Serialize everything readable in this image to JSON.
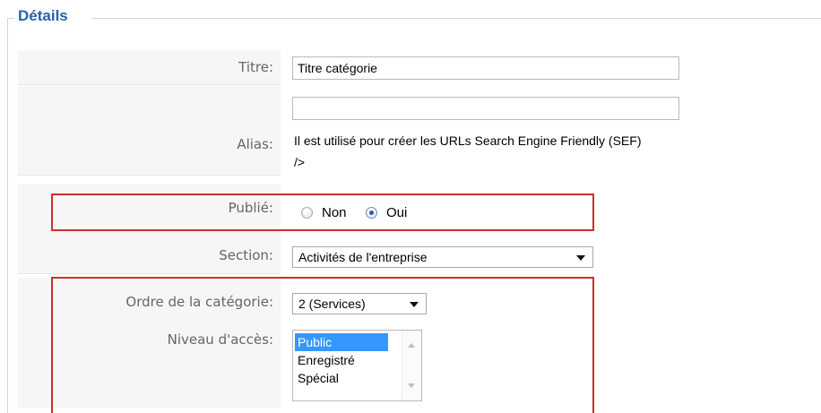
{
  "fieldset": {
    "legend": "Détails"
  },
  "titre": {
    "label": "Titre:",
    "value": "Titre catégorie"
  },
  "alias": {
    "label": "Alias:",
    "value": "",
    "help": "Il est utilisé pour créer les URLs Search Engine Friendly (SEF)",
    "help_cont": "/>"
  },
  "publie": {
    "label": "Publié:",
    "options": [
      {
        "label": "Non",
        "checked": false
      },
      {
        "label": "Oui",
        "checked": true
      }
    ]
  },
  "section": {
    "label": "Section:",
    "selected": "Activités de l'entreprise"
  },
  "ordre": {
    "label": "Ordre de la catégorie:",
    "selected": "2 (Services)"
  },
  "acces": {
    "label": "Niveau d'accès:",
    "options": [
      "Public",
      "Enregistré",
      "Spécial"
    ],
    "selected_index": 0
  },
  "colors": {
    "legend": "#2563a8",
    "highlight": "#c9302c",
    "selection": "#3399ff",
    "label_bg": "#f6f6f6"
  }
}
